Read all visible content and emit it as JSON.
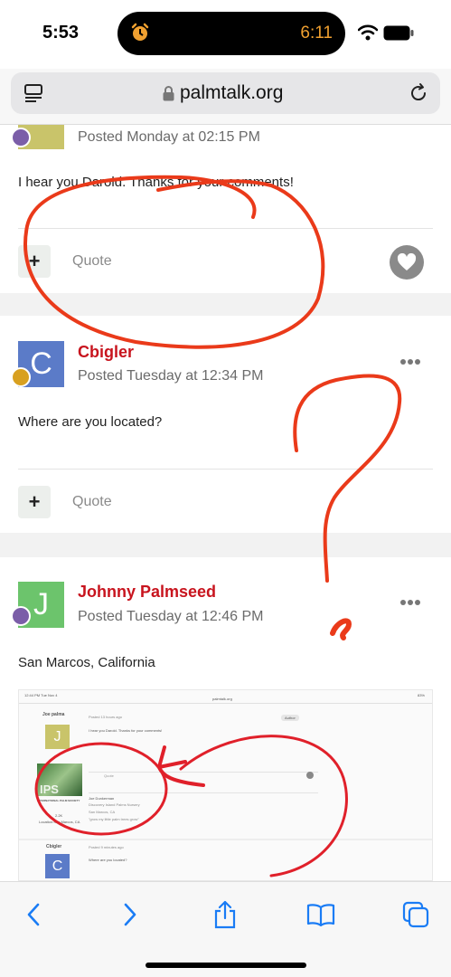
{
  "status_bar": {
    "time": "5:53",
    "alarm_time": "6:11"
  },
  "browser": {
    "url": "palmtalk.org"
  },
  "posts": [
    {
      "posted": "Posted Monday at 02:15 PM",
      "text": "I hear you Darold. Thanks for your comments!",
      "quote_label": "Quote"
    },
    {
      "author": "Cbigler",
      "avatar_letter": "C",
      "posted": "Posted Tuesday at 12:34 PM",
      "text": "Where are you located?",
      "quote_label": "Quote"
    },
    {
      "author": "Johnny Palmseed",
      "avatar_letter": "J",
      "posted": "Posted Tuesday at 12:46 PM",
      "text": "San Marcos, California"
    }
  ],
  "embedded_screenshot": {
    "status_left": "12:44 PM   Tue Nov 4",
    "status_right": "83%",
    "url": "palmtalk.org",
    "user1": "Joe palma",
    "avatar1": "J",
    "posted1": "Posted 13 hours ago",
    "text1": "I hear you Darold. Thanks for your comments!",
    "author_btn": "Author",
    "quote": "Quote",
    "sig_name": "Joe Dunkerman",
    "sig_line1": "Discovery Island Palms Nursery",
    "sig_line2": "San Marcos, CA",
    "sig_line3": "\"grow my little palm trees grow\"",
    "ips_logo": "IPS",
    "ips_caption": "INTERNATIONAL PALM SOCIETY",
    "post_count": "2.2K",
    "location": "Location:San Marcos, CA",
    "user2": "Cbigler",
    "avatar2": "C",
    "posted2": "Posted 9 minutes ago",
    "text2": "Where are you located?"
  },
  "colors": {
    "author_red": "#c8141e",
    "annotation_red": "#ea3a1a",
    "ios_blue": "#1a7cf5"
  },
  "icons": [
    "alarm-icon",
    "wifi-icon",
    "battery-icon",
    "reader-icon",
    "lock-icon",
    "reload-icon",
    "plus-icon",
    "heart-icon",
    "more-icon",
    "back-icon",
    "forward-icon",
    "share-icon",
    "bookmarks-icon",
    "tabs-icon"
  ]
}
